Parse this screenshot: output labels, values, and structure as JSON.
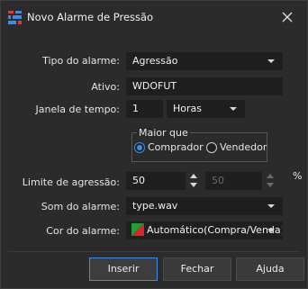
{
  "window": {
    "title": "Novo Alarme de Pressão",
    "app_icon": "grid-app-icon",
    "close_icon": "close-icon"
  },
  "form": {
    "tipo_label": "Tipo do alarme:",
    "tipo_value": "Agressão",
    "ativo_label": "Ativo:",
    "ativo_value": "WDOFUT",
    "janela_label": "Janela de tempo:",
    "janela_value": "1",
    "janela_unit": "Horas",
    "group_title": "Maior que",
    "radio_comprador": "Comprador",
    "radio_vendedor": "Vendedor",
    "selected_radio": "Comprador",
    "limite_label": "Limite de agressão:",
    "limite_value": "50",
    "percent_value": "50",
    "percent_symbol": "%",
    "som_label": "Som do alarme:",
    "som_value": "type.wav",
    "cor_label": "Cor do alarme:",
    "cor_value": "Automático(Compra/Venda)"
  },
  "buttons": {
    "inserir": "Inserir",
    "fechar": "Fechar",
    "ajuda": "Ajuda"
  },
  "colors": {
    "background": "#2b2b2b",
    "field": "#1f1f1f",
    "accent": "#3b8ee6",
    "swatch_buy": "#1e9e3a",
    "swatch_sell": "#d62828"
  }
}
